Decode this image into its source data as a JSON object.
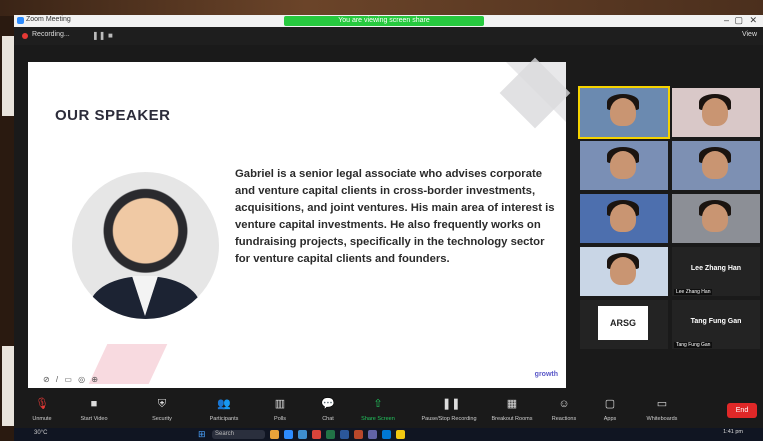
{
  "window": {
    "app_title": "Zoom Meeting",
    "share_banner": "You are viewing screen share",
    "view_label": "View"
  },
  "topbar": {
    "recording_label": "Recording..."
  },
  "slide": {
    "title": "OUR SPEAKER",
    "bio": "Gabriel is a senior legal associate who advises corporate and venture capital clients in cross-border investments, acquisitions, and joint ventures. His main area of interest is venture capital investments. He also frequently works on fundraising projects, specifically in the technology sector for venture capital clients and founders.",
    "tools": "⊘ / ▭ ◎ ⊕",
    "logo": "growth"
  },
  "gallery": {
    "tiles": [
      {
        "name": "",
        "speaking": true
      },
      {
        "name": "",
        "speaking": false
      },
      {
        "name": "",
        "speaking": false
      },
      {
        "name": "",
        "speaking": false
      },
      {
        "name": "",
        "speaking": false
      },
      {
        "name": "",
        "speaking": false
      },
      {
        "name": "",
        "speaking": false
      },
      {
        "big_name": "Lee Zhang Han",
        "name": "Lee Zhang Han"
      },
      {
        "logo": "ARSG",
        "name": ""
      },
      {
        "big_name": "Tang Fung Gan",
        "name": "Tang Fung Gan"
      }
    ]
  },
  "toolbar": {
    "items": [
      {
        "label": "Unmute",
        "icon": "microphone-icon"
      },
      {
        "label": "Start Video",
        "icon": "video-icon"
      },
      {
        "label": "Security",
        "icon": "shield-icon"
      },
      {
        "label": "Participants",
        "icon": "participants-icon"
      },
      {
        "label": "Polls",
        "icon": "polls-icon"
      },
      {
        "label": "Chat",
        "icon": "chat-icon"
      },
      {
        "label": "Share Screen",
        "icon": "share-screen-icon"
      },
      {
        "label": "Pause/Stop Recording",
        "icon": "recording-icon"
      },
      {
        "label": "Breakout Rooms",
        "icon": "breakout-rooms-icon"
      },
      {
        "label": "Reactions",
        "icon": "reactions-icon"
      },
      {
        "label": "Apps",
        "icon": "apps-icon"
      },
      {
        "label": "Whiteboards",
        "icon": "whiteboard-icon"
      }
    ],
    "end_label": "End"
  },
  "taskbar": {
    "search": "Search",
    "weather": "30°C",
    "time": "1:41 pm",
    "date": ""
  }
}
